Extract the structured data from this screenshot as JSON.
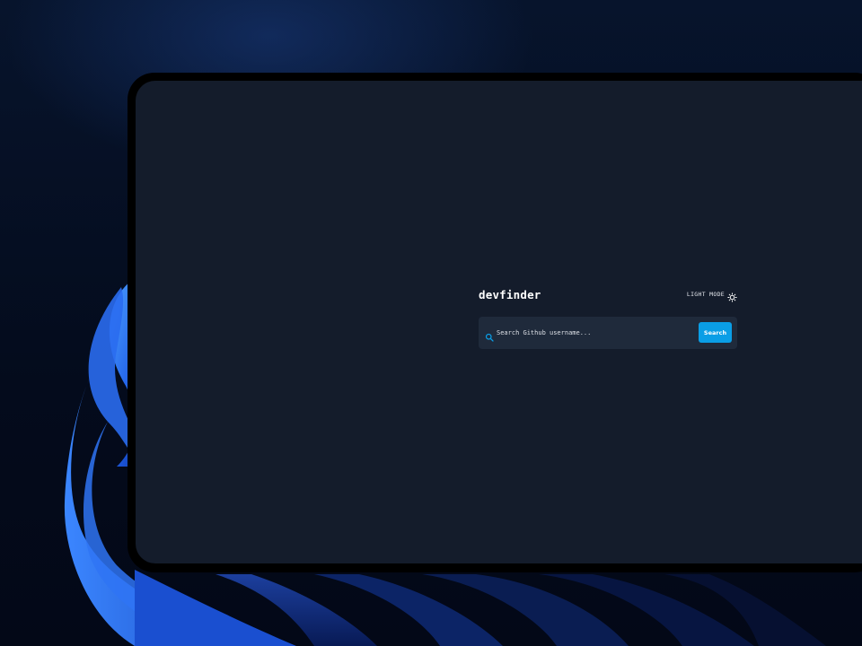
{
  "app": {
    "logo": "devfinder",
    "theme_toggle": {
      "label": "LIGHT MODE",
      "icon": "sun-icon"
    },
    "search": {
      "placeholder": "Search Github username...",
      "value": "",
      "icon": "search-icon",
      "button_label": "Search"
    }
  },
  "colors": {
    "app_background": "#141c2b",
    "search_background": "#1f2a3b",
    "accent": "#0a9ee6",
    "text": "#ffffff",
    "window_bezel": "#000000",
    "desktop_background": "#050d1f"
  }
}
